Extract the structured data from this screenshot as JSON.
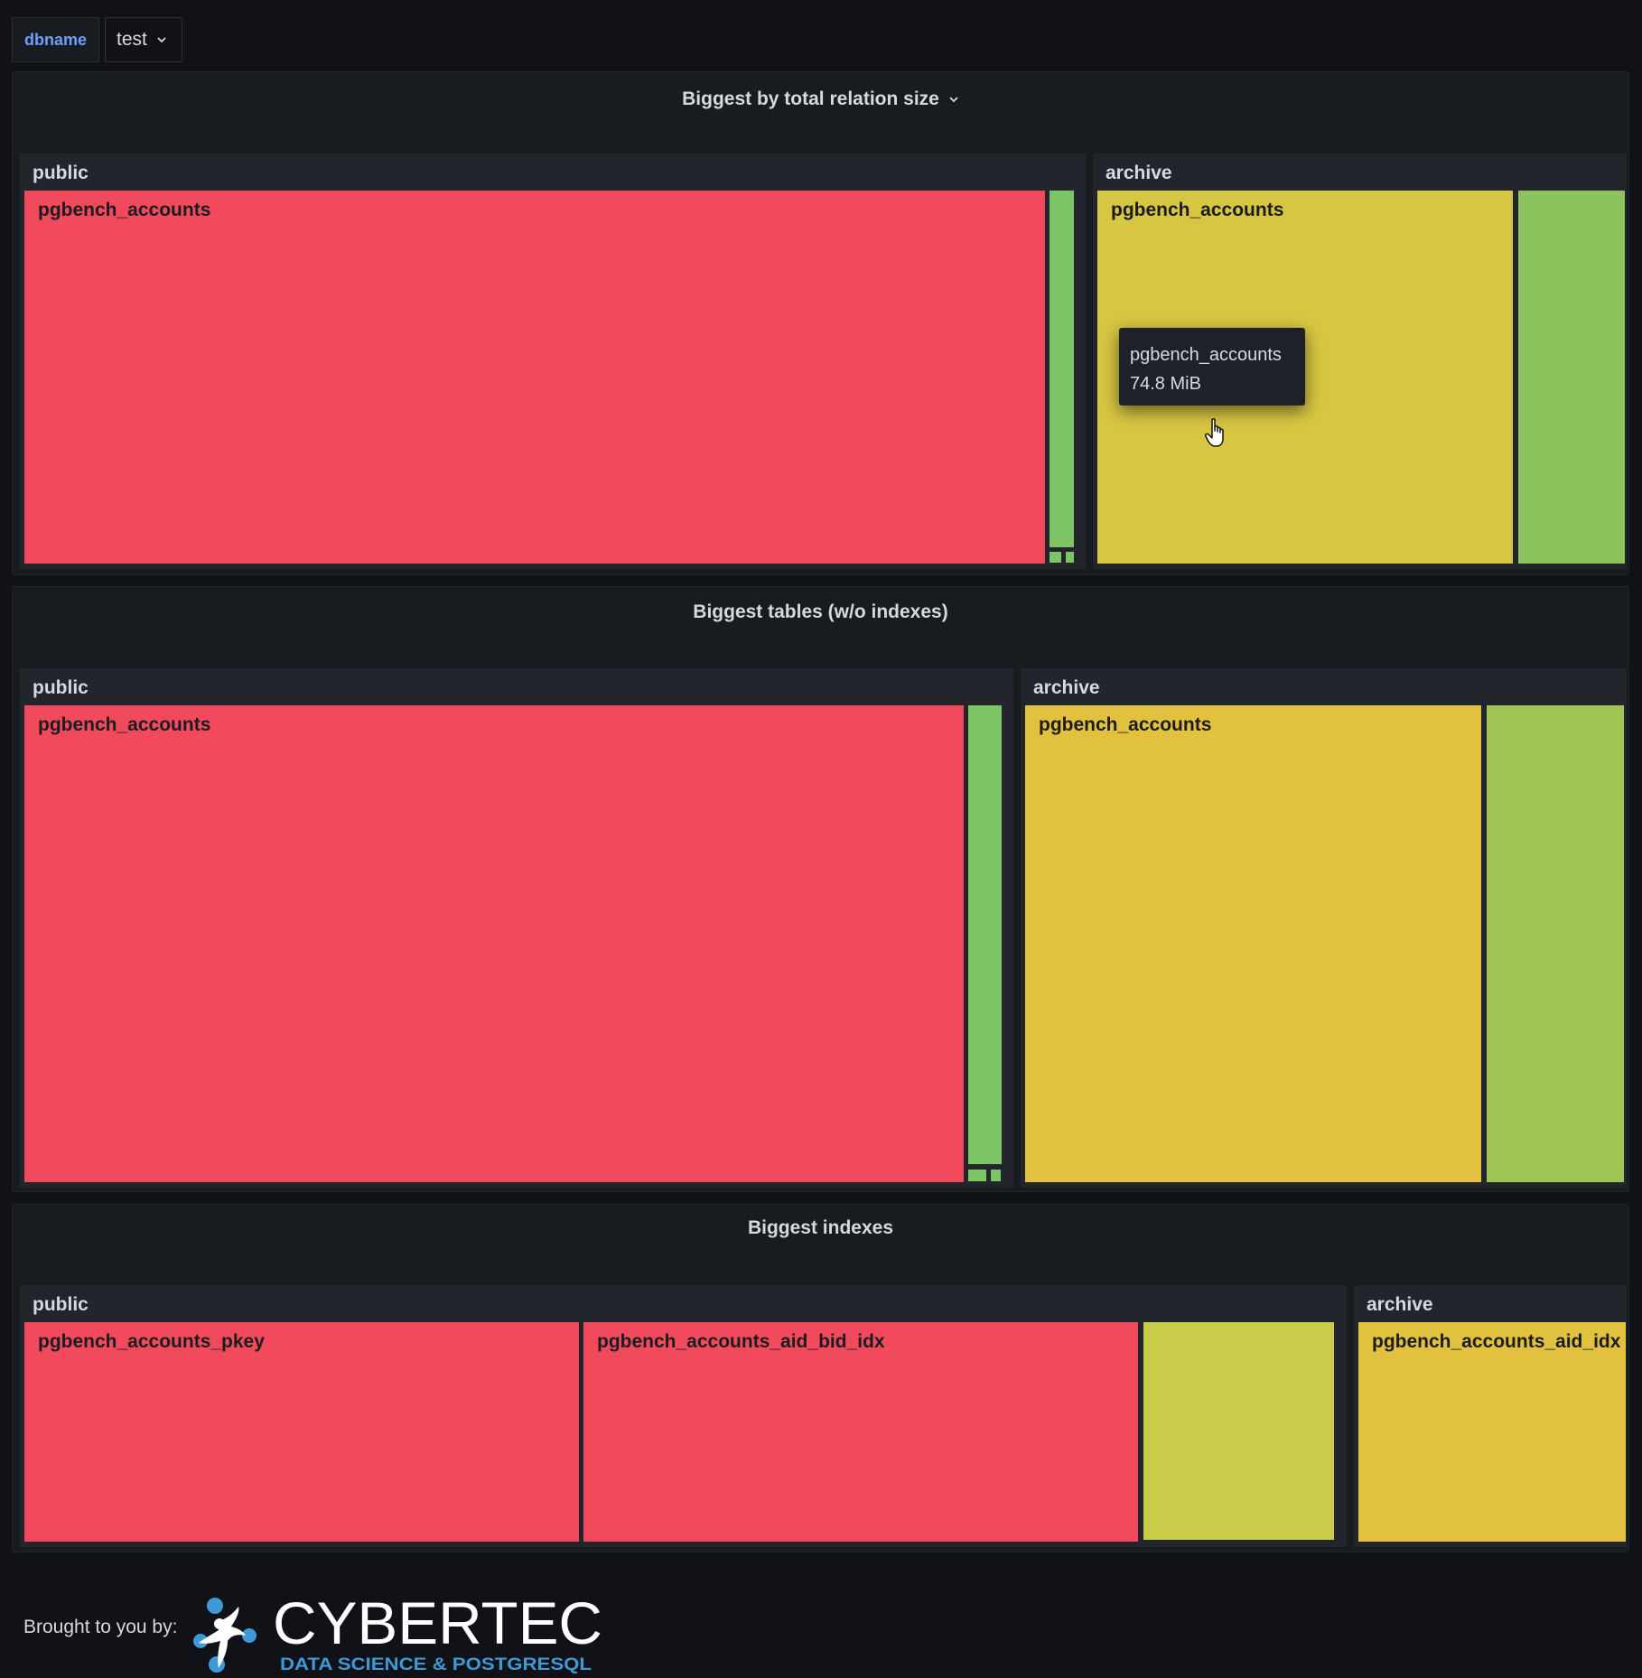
{
  "variables": {
    "label": "dbname",
    "selected": "test"
  },
  "panels": [
    {
      "title": "Biggest by total relation size",
      "groups": [
        {
          "name": "public",
          "cells": [
            {
              "label": "pgbench_accounts"
            }
          ]
        },
        {
          "name": "archive",
          "cells": [
            {
              "label": "pgbench_accounts"
            }
          ]
        }
      ]
    },
    {
      "title": "Biggest tables (w/o indexes)",
      "groups": [
        {
          "name": "public",
          "cells": [
            {
              "label": "pgbench_accounts"
            }
          ]
        },
        {
          "name": "archive",
          "cells": [
            {
              "label": "pgbench_accounts"
            }
          ]
        }
      ]
    },
    {
      "title": "Biggest indexes",
      "groups": [
        {
          "name": "public",
          "cells": [
            {
              "label": "pgbench_accounts_pkey"
            },
            {
              "label": "pgbench_accounts_aid_bid_idx"
            }
          ]
        },
        {
          "name": "archive",
          "cells": [
            {
              "label": "pgbench_accounts_aid_idx"
            }
          ]
        }
      ]
    }
  ],
  "tooltip": {
    "name": "pgbench_accounts",
    "value": "74.8 MiB"
  },
  "footer": {
    "text": "Brought to you by:",
    "logo_main": "CYBERTEC",
    "logo_sub": "DATA SCIENCE & POSTGRESQL"
  },
  "colors": {
    "red": "#f24a5d",
    "green": "#7cc466",
    "yellow": "#d7c642",
    "orange_yellow": "#e2c13f",
    "accent_blue": "#6e9fff"
  }
}
